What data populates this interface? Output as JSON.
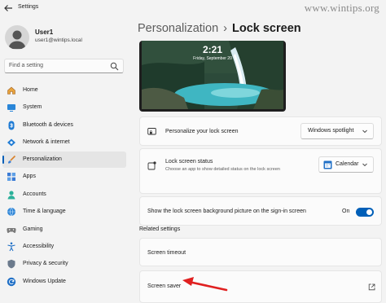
{
  "window": {
    "title": "Settings"
  },
  "watermark": "www.wintips.org",
  "user": {
    "name": "User1",
    "email": "user1@wintips.local"
  },
  "search": {
    "placeholder": "Find a setting"
  },
  "sidebar": {
    "items": [
      {
        "label": "Home",
        "icon": "home-icon",
        "active": false
      },
      {
        "label": "System",
        "icon": "system-icon",
        "active": false
      },
      {
        "label": "Bluetooth & devices",
        "icon": "bluetooth-icon",
        "active": false
      },
      {
        "label": "Network & internet",
        "icon": "network-icon",
        "active": false
      },
      {
        "label": "Personalization",
        "icon": "brush-icon",
        "active": true
      },
      {
        "label": "Apps",
        "icon": "apps-icon",
        "active": false
      },
      {
        "label": "Accounts",
        "icon": "accounts-icon",
        "active": false
      },
      {
        "label": "Time & language",
        "icon": "globe-icon",
        "active": false
      },
      {
        "label": "Gaming",
        "icon": "gaming-icon",
        "active": false
      },
      {
        "label": "Accessibility",
        "icon": "accessibility-icon",
        "active": false
      },
      {
        "label": "Privacy & security",
        "icon": "shield-icon",
        "active": false
      },
      {
        "label": "Windows Update",
        "icon": "update-icon",
        "active": false
      }
    ]
  },
  "header": {
    "breadcrumb": "Personalization",
    "separator": "›",
    "title": "Lock screen"
  },
  "preview": {
    "time": "2:21",
    "date": "Friday, September 20"
  },
  "settings": {
    "personalize": {
      "label": "Personalize your lock screen",
      "value": "Windows spotlight"
    },
    "status": {
      "label": "Lock screen status",
      "description": "Choose an app to show detailed status on the lock screen",
      "value": "Calendar"
    },
    "background": {
      "label": "Show the lock screen background picture on the sign-in screen",
      "state": "On",
      "on": true
    }
  },
  "related": {
    "title": "Related settings",
    "items": [
      {
        "label": "Screen timeout"
      },
      {
        "label": "Screen saver"
      }
    ]
  },
  "colors": {
    "accent": "#005fb8",
    "arrow": "#e02020"
  }
}
